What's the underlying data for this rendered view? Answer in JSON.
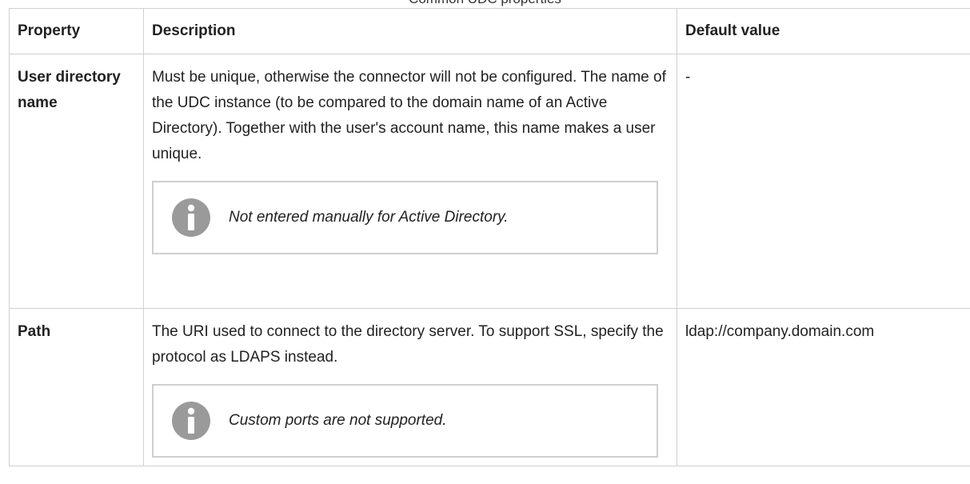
{
  "table": {
    "caption": "Common UDC properties",
    "headers": {
      "property": "Property",
      "description": "Description",
      "default_value": "Default value"
    },
    "rows": [
      {
        "property": "User directory name",
        "description": "Must be unique, otherwise the connector will not be configured. The name of the UDC instance (to be compared to the domain name of an Active Directory). Together with the user's account name, this name makes a user unique.",
        "note": "Not entered manually for Active Directory.",
        "default_value": "-"
      },
      {
        "property": "Path",
        "description": "The URI used to connect to the directory server. To support SSL, specify the protocol as LDAPS instead.",
        "note": "Custom ports are not supported.",
        "default_value": "ldap://company.domain.com"
      }
    ]
  },
  "icons": {
    "note_icon": "info-icon"
  },
  "colors": {
    "border": "#d0d0d0",
    "info_icon": "#9a9a9a"
  }
}
